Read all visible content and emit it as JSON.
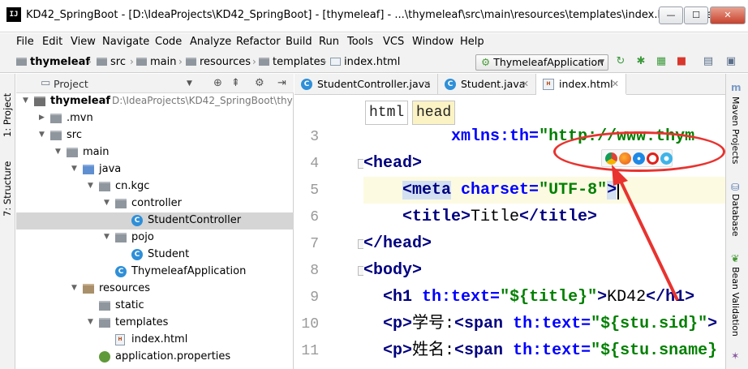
{
  "window": {
    "title": "KD42_SpringBoot - [D:\\IdeaProjects\\KD42_SpringBoot] - [thymeleaf] - ...\\thymeleaf\\src\\main\\resources\\templates\\index.html - Intelli",
    "app_icon": "IJ",
    "minimize": "—",
    "maximize": "☐",
    "close": "✕"
  },
  "menu": [
    "File",
    "Edit",
    "View",
    "Navigate",
    "Code",
    "Analyze",
    "Refactor",
    "Build",
    "Run",
    "Tools",
    "VCS",
    "Window",
    "Help"
  ],
  "breadcrumb": [
    "thymeleaf",
    "src",
    "main",
    "resources",
    "templates",
    "index.html"
  ],
  "run_config": "ThymeleafApplication",
  "side_tabs": {
    "project": "1: Project",
    "structure": "7: Structure"
  },
  "right_tabs": [
    "Maven Projects",
    "Database",
    "Bean Validation"
  ],
  "project_panel": {
    "title": "Project",
    "tree": [
      {
        "label": "thymeleaf",
        "extra": "D:\\IdeaProjects\\KD42_SpringBoot\\thy",
        "depth": 0,
        "icon": "root-folder-icon",
        "open": true
      },
      {
        "label": ".mvn",
        "depth": 1,
        "icon": "folder-icon",
        "open": false
      },
      {
        "label": "src",
        "depth": 1,
        "icon": "folder-icon",
        "open": true
      },
      {
        "label": "main",
        "depth": 2,
        "icon": "folder-icon",
        "open": true
      },
      {
        "label": "java",
        "depth": 3,
        "icon": "source-folder-icon",
        "open": true
      },
      {
        "label": "cn.kgc",
        "depth": 4,
        "icon": "package-icon",
        "open": true
      },
      {
        "label": "controller",
        "depth": 5,
        "icon": "package-icon",
        "open": true
      },
      {
        "label": "StudentController",
        "depth": 6,
        "icon": "class-icon",
        "selected": true
      },
      {
        "label": "pojo",
        "depth": 5,
        "icon": "package-icon",
        "open": true
      },
      {
        "label": "Student",
        "depth": 6,
        "icon": "class-icon"
      },
      {
        "label": "ThymeleafApplication",
        "depth": 5,
        "icon": "spring-class-icon"
      },
      {
        "label": "resources",
        "depth": 3,
        "icon": "resources-folder-icon",
        "open": true
      },
      {
        "label": "static",
        "depth": 4,
        "icon": "folder-icon"
      },
      {
        "label": "templates",
        "depth": 4,
        "icon": "folder-icon",
        "open": true
      },
      {
        "label": "index.html",
        "depth": 5,
        "icon": "html-file-icon"
      },
      {
        "label": "application.properties",
        "depth": 4,
        "icon": "properties-file-icon"
      }
    ]
  },
  "editor_tabs": [
    {
      "label": "StudentController.java",
      "icon": "C"
    },
    {
      "label": "Student.java",
      "icon": "C"
    },
    {
      "label": "index.html",
      "icon": "H",
      "active": true
    }
  ],
  "tag_breadcrumb": [
    "html",
    "head"
  ],
  "code_lines": [
    {
      "n": "3",
      "text": "        xmlns:th=\"http://www.thym"
    },
    {
      "n": "4",
      "text": "<head>"
    },
    {
      "n": "5",
      "text": "    <meta charset=\"UTF-8\">"
    },
    {
      "n": "6",
      "text": "    <title>Title</title>"
    },
    {
      "n": "7",
      "text": "</head>"
    },
    {
      "n": "8",
      "text": "<body>"
    },
    {
      "n": "9",
      "text": "  <h1 th:text=\"${title}\">KD42</h1>"
    },
    {
      "n": "10",
      "text": "  <p>学号:<span th:text=\"${stu.sid}\">"
    },
    {
      "n": "11",
      "text": "  <p>姓名:<span th:text=\"${stu.sname}"
    }
  ],
  "colors": {
    "tag": "#000080",
    "attr": "#0000ff",
    "value": "#008000",
    "annotation": "#e8332f",
    "current_line": "#fcfae1"
  },
  "browser_icons": [
    "chrome-icon",
    "firefox-icon",
    "safari-icon",
    "opera-icon",
    "ie-icon"
  ]
}
